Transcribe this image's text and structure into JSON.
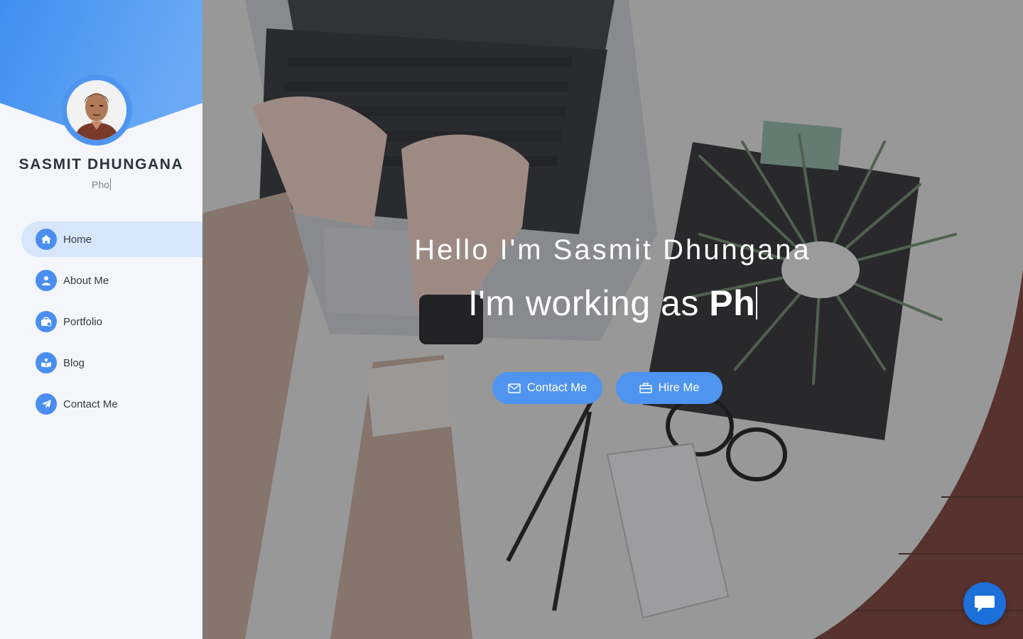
{
  "profile": {
    "name": "SASMIT DHUNGANA",
    "role_typed": "Pho"
  },
  "nav": {
    "items": [
      {
        "label": "Home",
        "icon": "home-icon",
        "active": true
      },
      {
        "label": "About Me",
        "icon": "user-icon",
        "active": false
      },
      {
        "label": "Portfolio",
        "icon": "briefcase-icon",
        "active": false
      },
      {
        "label": "Blog",
        "icon": "book-icon",
        "active": false
      },
      {
        "label": "Contact Me",
        "icon": "paper-plane-icon",
        "active": false
      }
    ]
  },
  "hero": {
    "greeting": "Hello I'm Sasmit Dhungana",
    "working_prefix": "I'm working as ",
    "working_typed": "Ph",
    "buttons": {
      "contact": {
        "label": "Contact Me",
        "icon": "envelope-icon"
      },
      "hire": {
        "label": "Hire Me",
        "icon": "briefcase-icon"
      }
    }
  },
  "chat": {
    "icon": "chat-bubble-icon"
  },
  "colors": {
    "accent": "#4f94ef",
    "active_nav_bg": "#d7e6fa",
    "sidebar_bg": "#f4f6fb",
    "chat_button": "#1d6fd9"
  }
}
